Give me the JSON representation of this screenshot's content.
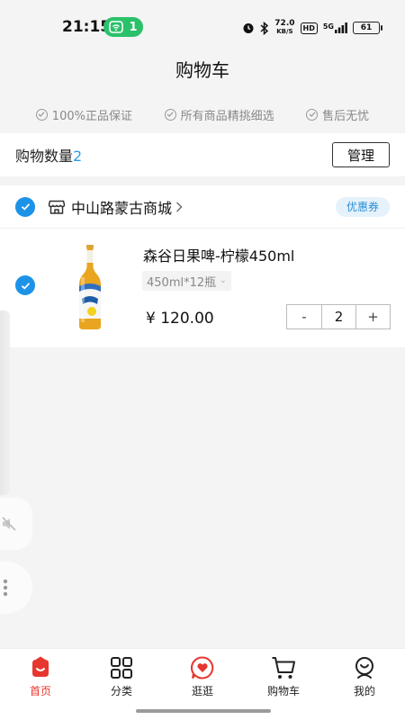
{
  "status_bar": {
    "time": "21:15",
    "hotspot_count": "1",
    "net_speed_value": "72.0",
    "net_speed_unit": "KB/S",
    "hd": "HD",
    "signal": "5G",
    "battery": "61"
  },
  "header": {
    "title": "购物车"
  },
  "guarantees": [
    {
      "label": "100%正品保证"
    },
    {
      "label": "所有商品精挑细选"
    },
    {
      "label": "售后无忧"
    }
  ],
  "cart": {
    "count_label": "购物数量",
    "count_value": "2",
    "manage_label": "管理"
  },
  "store": {
    "name": "中山路蒙古商城",
    "coupon_label": "优惠券",
    "items": [
      {
        "name": "森谷日果啤-柠檬450ml",
        "spec": "450ml*12瓶",
        "price": "¥ 120.00",
        "quantity": "2",
        "minus_label": "-",
        "plus_label": "+"
      }
    ]
  },
  "bottom_nav": [
    {
      "label": "首页",
      "icon": "home-icon",
      "active": true
    },
    {
      "label": "分类",
      "icon": "grid-icon",
      "active": false
    },
    {
      "label": "逛逛",
      "icon": "heart-chat-icon",
      "active": false
    },
    {
      "label": "购物车",
      "icon": "cart-icon",
      "active": false
    },
    {
      "label": "我的",
      "icon": "profile-icon",
      "active": false
    }
  ],
  "colors": {
    "accent_blue": "#1d93e8",
    "nav_active": "#e6362f",
    "hotspot_green": "#2bc16b"
  }
}
